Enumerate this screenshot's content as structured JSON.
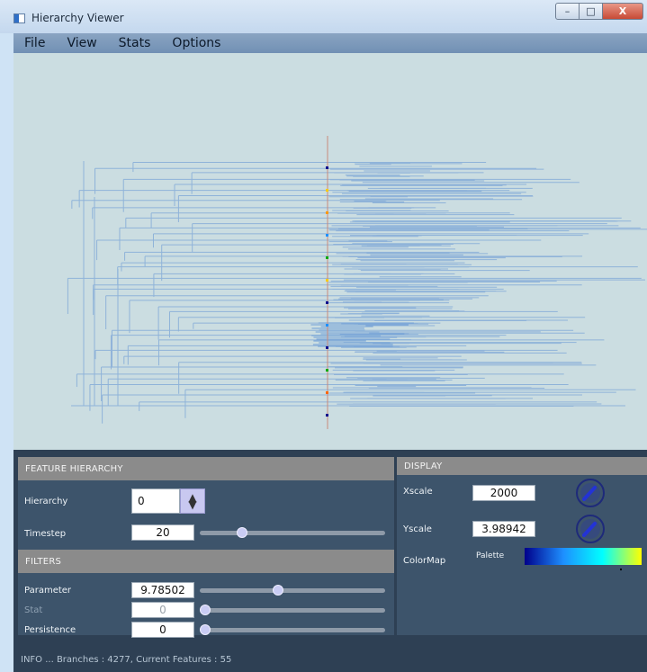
{
  "window": {
    "title": "Hierarchy Viewer",
    "app_icon": "window-app-icon"
  },
  "controls": {
    "minimize": "–",
    "maximize": "□",
    "close": "X"
  },
  "menu": [
    "File",
    "View",
    "Stats",
    "Options"
  ],
  "feature_hierarchy": {
    "header": "FEATURE HIERARCHY",
    "hierarchy_label": "Hierarchy",
    "hierarchy_value": "0",
    "timestep_label": "Timestep",
    "timestep_value": "20",
    "timestep_slider_fraction": 0.21
  },
  "filters": {
    "header": "FILTERS",
    "parameter_label": "Parameter",
    "parameter_value": "9.78502",
    "parameter_slider_fraction": 0.42,
    "stat_label": "Stat",
    "stat_value": "0",
    "stat_slider_fraction": 0.0,
    "persistence_label": "Persistence",
    "persistence_value": "0",
    "persistence_slider_fraction": 0.0
  },
  "display": {
    "header": "DISPLAY",
    "xscale_label": "Xscale",
    "xscale_value": "2000",
    "yscale_label": "Yscale",
    "yscale_value": "3.98942",
    "colormap_label": "ColorMap",
    "palette_label": "Palette",
    "colormap_colors": [
      "#00008b",
      "#1e90ff",
      "#00ffff",
      "#ffff00"
    ]
  },
  "status": {
    "text": "INFO ...    Branches : 4277, Current Features : 55"
  },
  "colors": {
    "tree_line": "#8fb3d9",
    "axis_line": "#c98a7a",
    "panel_bg": "#2e4054",
    "section_bg": "#3d546b",
    "header_bg": "#8b8b8b"
  }
}
